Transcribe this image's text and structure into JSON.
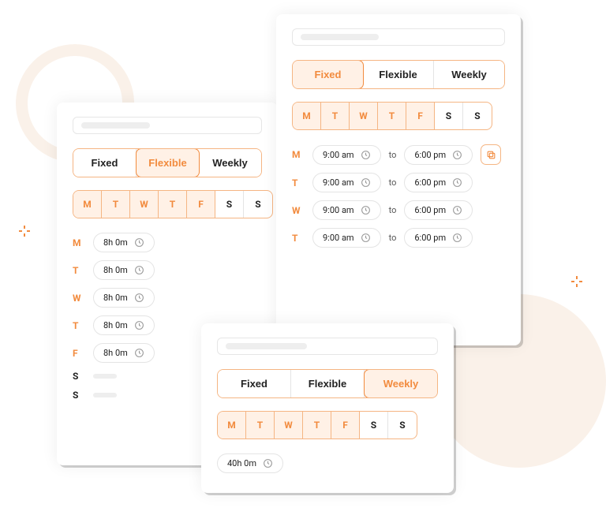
{
  "colors": {
    "accent": "#f28b3e",
    "accent_bg": "#fff1e6"
  },
  "tabs": {
    "fixed": "Fixed",
    "flexible": "Flexible",
    "weekly": "Weekly"
  },
  "days": {
    "short": [
      "M",
      "T",
      "W",
      "T",
      "F",
      "S",
      "S"
    ]
  },
  "misc": {
    "to": "to"
  },
  "left_card": {
    "active_tab": "Flexible",
    "rows": [
      {
        "day": "M",
        "value": "8h 0m"
      },
      {
        "day": "T",
        "value": "8h 0m"
      },
      {
        "day": "W",
        "value": "8h 0m"
      },
      {
        "day": "T",
        "value": "8h 0m"
      },
      {
        "day": "F",
        "value": "8h 0m"
      }
    ],
    "weekend": [
      "S",
      "S"
    ]
  },
  "right_card": {
    "active_tab": "Fixed",
    "rows": [
      {
        "day": "M",
        "start": "9:00 am",
        "end": "6:00 pm"
      },
      {
        "day": "T",
        "start": "9:00 am",
        "end": "6:00 pm"
      },
      {
        "day": "W",
        "start": "9:00 am",
        "end": "6:00 pm"
      },
      {
        "day": "T",
        "start": "9:00 am",
        "end": "6:00 pm"
      }
    ]
  },
  "bottom_card": {
    "active_tab": "Weekly",
    "total": "40h 0m"
  }
}
